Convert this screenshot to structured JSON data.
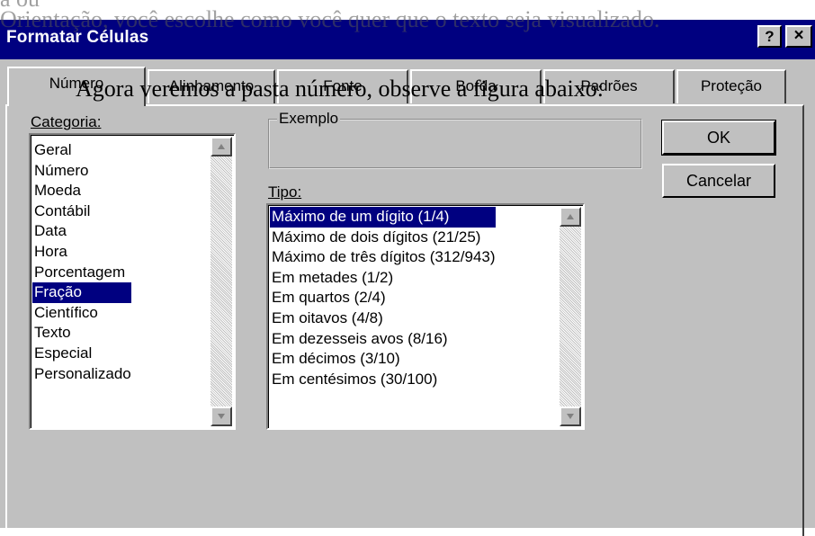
{
  "page": {
    "overlay_top": "Orientação, você escolhe como você quer que o texto seja visualizado.",
    "overlay_caption": "Agora veremos a pasta número, observe a figura abaixo:"
  },
  "dialog": {
    "title": "Formatar Células",
    "help_glyph": "?",
    "close_glyph": "×"
  },
  "tabs": [
    {
      "label": "Número",
      "active": true
    },
    {
      "label": "Alinhamento",
      "active": false
    },
    {
      "label": "Fonte",
      "active": false
    },
    {
      "label": "Borda",
      "active": false
    },
    {
      "label": "Padrões",
      "active": false
    },
    {
      "label": "Proteção",
      "active": false
    }
  ],
  "category": {
    "label": "Categoria:",
    "items": [
      "Geral",
      "Número",
      "Moeda",
      "Contábil",
      "Data",
      "Hora",
      "Porcentagem",
      "Fração",
      "Científico",
      "Texto",
      "Especial",
      "Personalizado"
    ],
    "selected": "Fração"
  },
  "example": {
    "label": "Exemplo"
  },
  "type": {
    "label": "Tipo:",
    "items": [
      "Máximo de um dígito (1/4)",
      "Máximo de dois dígitos (21/25)",
      "Máximo de três dígitos (312/943)",
      "Em metades (1/2)",
      "Em quartos (2/4)",
      "Em oitavos (4/8)",
      "Em dezesseis avos (8/16)",
      "Em décimos (3/10)",
      "Em centésimos (30/100)"
    ],
    "selected": "Máximo de um dígito (1/4)"
  },
  "buttons": {
    "ok": "OK",
    "cancel": "Cancelar"
  },
  "colors": {
    "titlebar": "#000080",
    "face": "#c0c0c0",
    "selection": "#000080"
  }
}
